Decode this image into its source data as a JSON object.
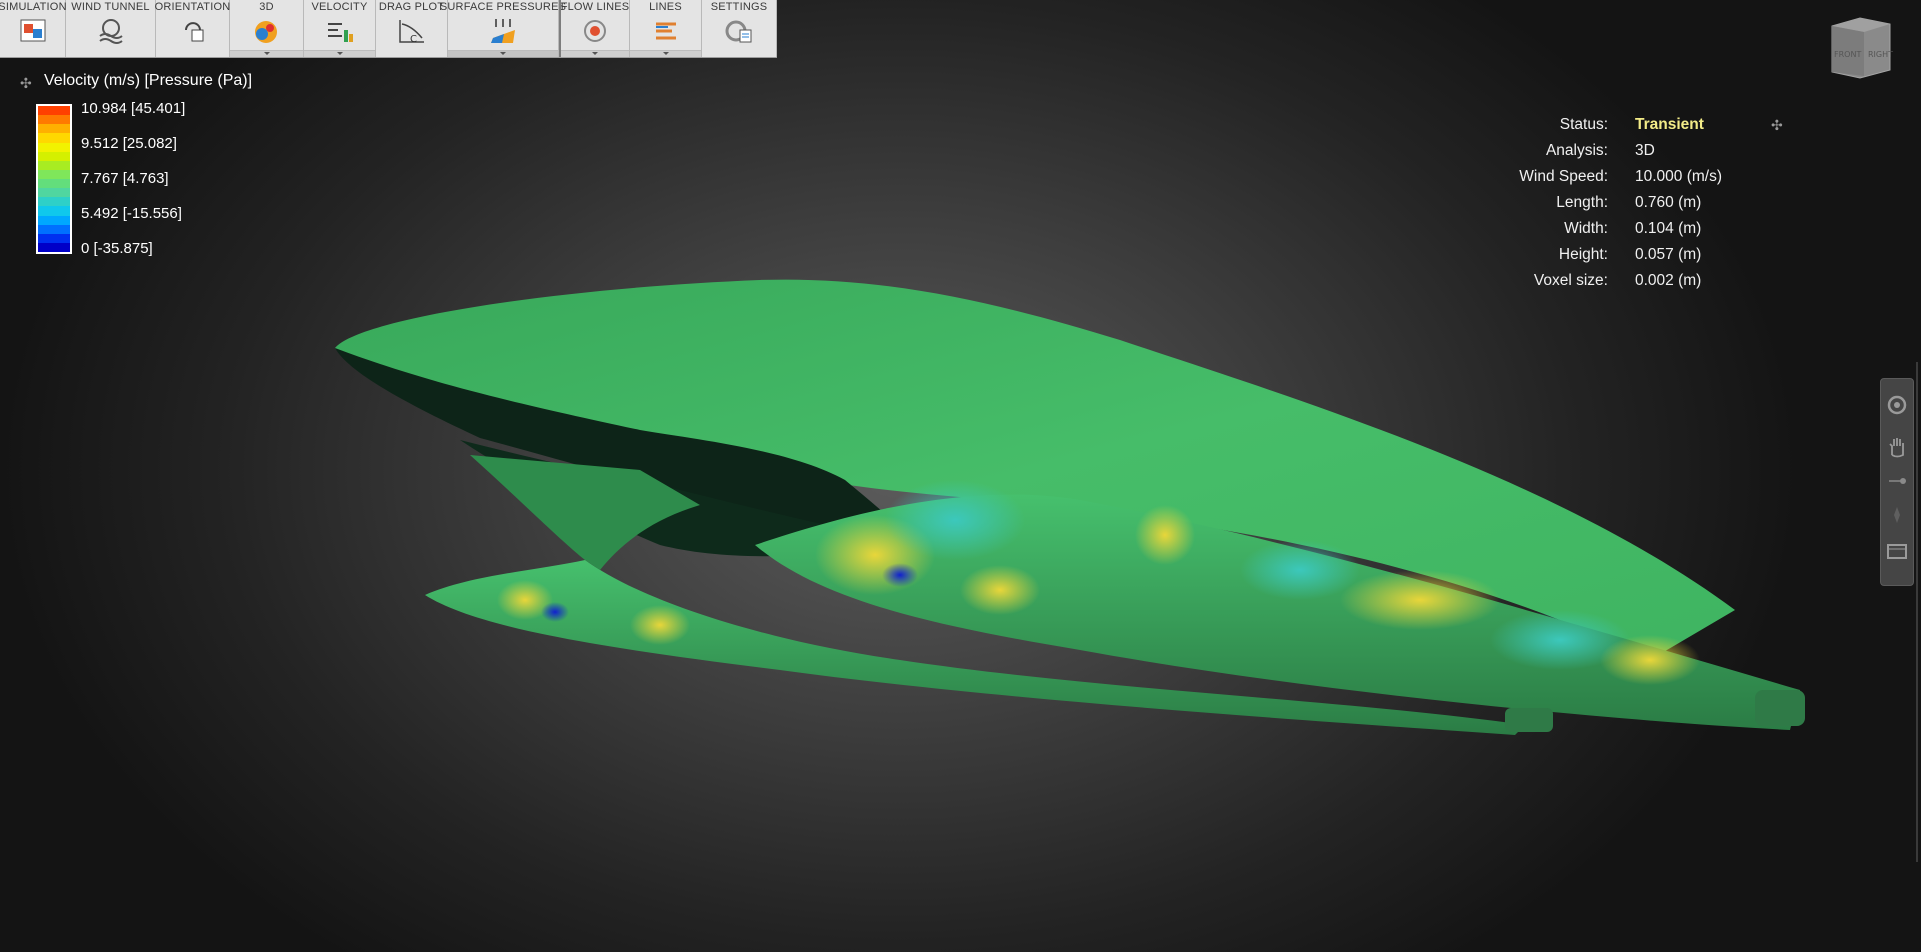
{
  "toolbar": {
    "items": [
      {
        "label": "SIMULATION",
        "icon": "simulation-icon"
      },
      {
        "label": "WIND TUNNEL",
        "icon": "wind-tunnel-icon"
      },
      {
        "label": "ORIENTATION",
        "icon": "orientation-icon"
      },
      {
        "label": "3D",
        "icon": "3d-icon",
        "dropdown": true
      },
      {
        "label": "VELOCITY",
        "icon": "velocity-icon",
        "dropdown": true
      },
      {
        "label": "DRAG PLOT",
        "icon": "drag-plot-icon"
      },
      {
        "label": "SURFACE PRESSURES",
        "icon": "surface-pressures-icon",
        "dropdown_strip": true
      },
      {
        "label": "FLOW LINES",
        "icon": "flow-lines-icon",
        "dropdown": true
      },
      {
        "label": "LINES",
        "icon": "lines-icon",
        "dropdown": true
      },
      {
        "label": "SETTINGS",
        "icon": "settings-icon"
      }
    ]
  },
  "legend": {
    "title": "Velocity (m/s) [Pressure (Pa)]",
    "ticks": [
      "10.984 [45.401]",
      "9.512 [25.082]",
      "7.767 [4.763]",
      "5.492 [-15.556]",
      "0 [-35.875]"
    ],
    "colors": [
      "#ff4000",
      "#ff7a00",
      "#ffb000",
      "#ffd800",
      "#f2f200",
      "#d4f000",
      "#a8ec22",
      "#7fe65a",
      "#63de7c",
      "#50d6a0",
      "#2ed0c8",
      "#10c8ec",
      "#00a8ff",
      "#0070ff",
      "#0030f0",
      "#0000c8"
    ]
  },
  "status": {
    "rows": [
      {
        "label": "Status:",
        "value": "Transient"
      },
      {
        "label": "Analysis:",
        "value": "3D"
      },
      {
        "label": "Wind Speed:",
        "value": "10.000 (m/s)"
      },
      {
        "label": "Length:",
        "value": "0.760 (m)"
      },
      {
        "label": "Width:",
        "value": "0.104 (m)"
      },
      {
        "label": "Height:",
        "value": "0.057 (m)"
      },
      {
        "label": "Voxel size:",
        "value": "0.002 (m)"
      }
    ]
  },
  "viewcube": {
    "face_front": "FRONT",
    "face_right": "RIGHT"
  },
  "navbar": {
    "buttons": [
      "orbit-icon",
      "pan-icon",
      "zoom-slider-icon",
      "look-icon",
      "film-icon"
    ]
  },
  "colors": {
    "accent_status": "#f3ec88",
    "model_green": "#46c06a"
  }
}
